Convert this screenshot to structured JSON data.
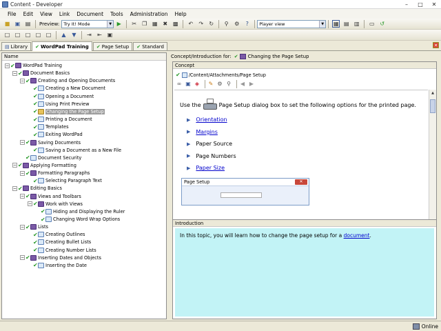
{
  "window": {
    "title": "Content - Developer"
  },
  "menu": [
    "File",
    "Edit",
    "View",
    "Link",
    "Document",
    "Tools",
    "Administration",
    "Help"
  ],
  "toolbar": {
    "preview_label": "Preview:",
    "preview_value": "Try It! Mode",
    "view_value": "Player view"
  },
  "tabs": [
    {
      "label": "Library",
      "active": false
    },
    {
      "label": "WordPad Training",
      "active": true
    },
    {
      "label": "Page Setup",
      "active": false
    },
    {
      "label": "Standard",
      "active": false
    }
  ],
  "tree": {
    "header": "Name",
    "items": [
      {
        "label": "WordPad Training",
        "icon": "book"
      },
      {
        "label": "Document Basics",
        "icon": "book"
      },
      {
        "label": "Creating and Opening Documents",
        "icon": "book"
      },
      {
        "label": "Creating a New Document",
        "icon": "page"
      },
      {
        "label": "Opening a Document",
        "icon": "page"
      },
      {
        "label": "Using Print Preview",
        "icon": "page"
      },
      {
        "label": "Changing the Page Setup",
        "icon": "gear",
        "selected": true
      },
      {
        "label": "Printing a Document",
        "icon": "page"
      },
      {
        "label": "Templates",
        "icon": "page"
      },
      {
        "label": "Exiting WordPad",
        "icon": "page"
      },
      {
        "label": "Saving Documents",
        "icon": "book"
      },
      {
        "label": "Saving a Document as a New File",
        "icon": "page"
      },
      {
        "label": "Document Security",
        "icon": "page"
      },
      {
        "label": "Applying Formatting",
        "icon": "book"
      },
      {
        "label": "Formatting Paragraphs",
        "icon": "book"
      },
      {
        "label": "Selecting Paragraph Text",
        "icon": "page"
      },
      {
        "label": "Editing Basics",
        "icon": "book"
      },
      {
        "label": "Views and Toolbars",
        "icon": "book"
      },
      {
        "label": "Work with Views",
        "icon": "book"
      },
      {
        "label": "Hiding and Displaying the Ruler",
        "icon": "page"
      },
      {
        "label": "Changing Word Wrap Options",
        "icon": "page"
      },
      {
        "label": "Lists",
        "icon": "book"
      },
      {
        "label": "Creating Outlines",
        "icon": "page"
      },
      {
        "label": "Creating Bullet Lists",
        "icon": "page"
      },
      {
        "label": "Creating Number Lists",
        "icon": "page"
      },
      {
        "label": "Inserting Dates and Objects",
        "icon": "book"
      },
      {
        "label": "Inserting the Date",
        "icon": "page"
      }
    ]
  },
  "right": {
    "header_label": "Concept/Introduction for:",
    "header_title": "Changing the Page Setup",
    "concept_label": "Concept",
    "path": "/Content/Attachments/Page Setup",
    "body_pre": "Use the",
    "body_post": "Page Setup dialog box to set the following options for the printed page.",
    "bullets": [
      {
        "text": "Orientation",
        "link": true
      },
      {
        "text": "Margins",
        "link": true
      },
      {
        "text": "Paper Source",
        "link": false
      },
      {
        "text": "Page Numbers",
        "link": false
      },
      {
        "text": "Paper Size",
        "link": true
      }
    ],
    "dialog_title": "Page Setup",
    "intro_label": "Introduction",
    "intro_text": "In this topic, you will learn how to change the page setup for a",
    "intro_link": "document",
    "intro_end": "."
  },
  "status": {
    "text": "Online"
  }
}
